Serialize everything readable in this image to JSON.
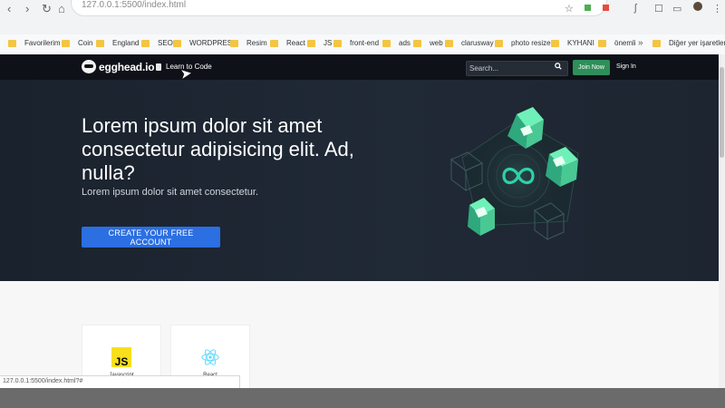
{
  "browser": {
    "address": "127.0.0.1:5500/index.html",
    "status_url": "127.0.0.1:5500/index.html?#",
    "bookmarks": [
      "Favorilerim",
      "Coin",
      "England",
      "SEO",
      "WORDPRESS",
      "Resim",
      "React",
      "JS",
      "front-end",
      "ads",
      "web",
      "clarusway",
      "photo resize",
      "KYHANI",
      "önemli"
    ],
    "more": "»",
    "other_bookmarks": "Diğer yer işaretleri"
  },
  "header": {
    "logo_text": "egghead.io",
    "learn_label": "Learn to Code",
    "search_placeholder": "Search...",
    "join_label": "Join Now",
    "signin_label": "Sign In"
  },
  "hero": {
    "title": "Lorem ipsum dolor sit amet consectetur adipisicing elit. Ad, nulla?",
    "subtitle": "Lorem ipsum dolor sit amet consectetur.",
    "cta_label": "CREATE YOUR FREE ACCOUNT"
  },
  "cards": [
    {
      "icon_text": "JS",
      "label": "Javascript"
    },
    {
      "label": "React"
    }
  ],
  "colors": {
    "header_bg": "#0e1218",
    "hero_bg": "#202936",
    "cta": "#2b6fe2",
    "join": "#2f8f5a",
    "js_yellow": "#f7df1e",
    "react_blue": "#61dafb",
    "cube_green": "#3ddc97"
  },
  "icons": [
    "back-icon",
    "forward-icon",
    "reload-icon",
    "home-icon",
    "star-icon",
    "book-icon",
    "search-icon",
    "cursor-icon",
    "infinity-icon",
    "react-icon",
    "folder-icon"
  ]
}
